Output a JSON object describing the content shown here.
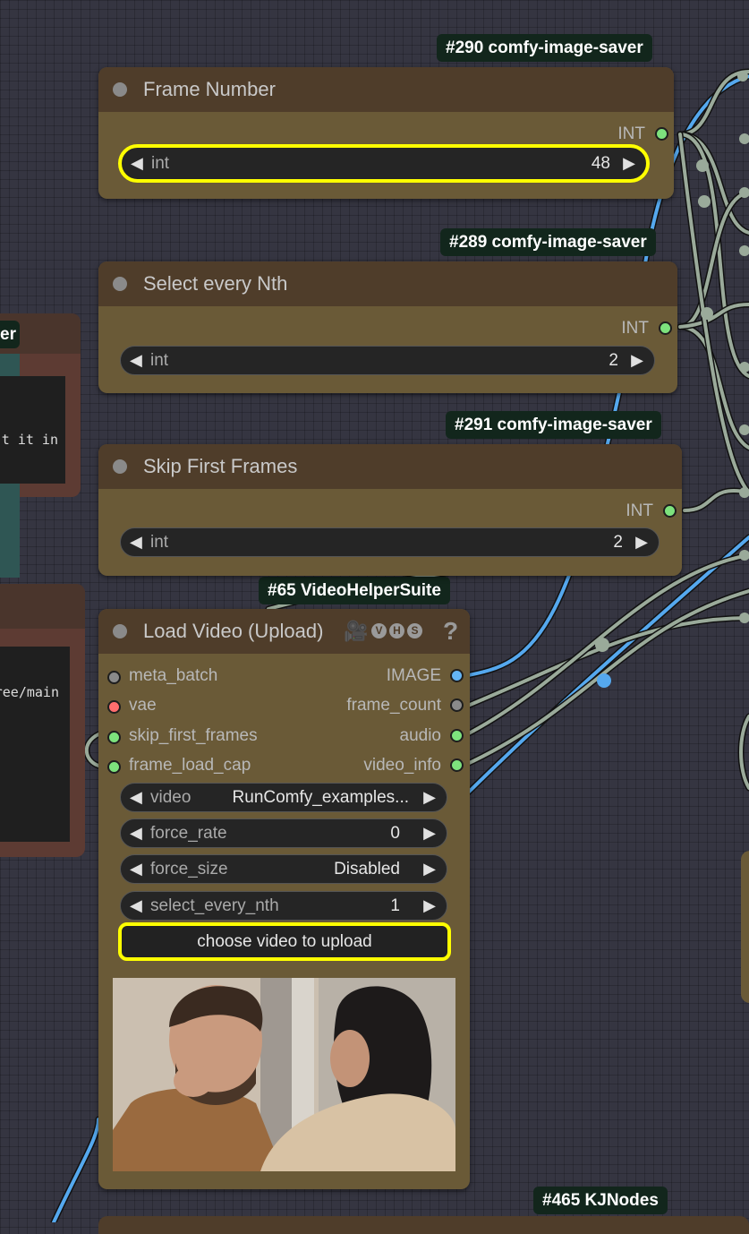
{
  "badges": {
    "b290": "#290 comfy-image-saver",
    "b289": "#289 comfy-image-saver",
    "b291": "#291 comfy-image-saver",
    "b65": "#65 VideoHelperSuite",
    "b465": "#465 KJNodes"
  },
  "frame_number": {
    "title": "Frame Number",
    "output": "INT",
    "widget": {
      "name": "int",
      "value": "48"
    }
  },
  "select_every_nth": {
    "title": "Select every Nth",
    "output": "INT",
    "widget": {
      "name": "int",
      "value": "2"
    }
  },
  "skip_first_frames": {
    "title": "Skip First Frames",
    "output": "INT",
    "widget": {
      "name": "int",
      "value": "2"
    }
  },
  "load_video": {
    "title": "Load Video (Upload)",
    "title_icons": "🎥",
    "vhs_letters": [
      "V",
      "H",
      "S"
    ],
    "help": "?",
    "inputs": [
      "meta_batch",
      "vae",
      "skip_first_frames",
      "frame_load_cap"
    ],
    "outputs": [
      "IMAGE",
      "frame_count",
      "audio",
      "video_info"
    ],
    "widgets": [
      {
        "name": "video",
        "value": "RunComfy_examples..."
      },
      {
        "name": "force_rate",
        "value": "0"
      },
      {
        "name": "force_size",
        "value": "Disabled"
      },
      {
        "name": "select_every_nth",
        "value": "1"
      }
    ],
    "upload_button": "choose video to upload"
  },
  "left_partial": {
    "header_fragment": "er",
    "text1": "t it in",
    "text2": "ree/main"
  },
  "colors": {
    "int_socket": "#7de27d",
    "image_socket": "#64b5f6",
    "vae_socket": "#ff6e6e",
    "gray_socket": "#8a8a8a",
    "highlight": "#ffff00",
    "wire_green": "#9aaa9a",
    "wire_blue": "#55a8ee"
  }
}
